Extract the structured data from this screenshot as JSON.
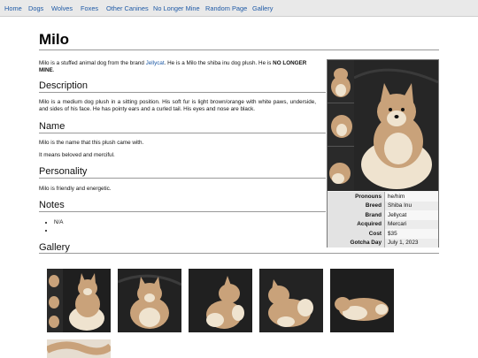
{
  "nav": {
    "items": [
      "Home",
      "Dogs",
      "Wolves",
      "Foxes",
      "Other Canines",
      "No Longer Mine",
      "Random Page",
      "Gallery"
    ]
  },
  "page": {
    "title": "Milo",
    "intro_pre": "Milo is a stuffed animal dog from the brand ",
    "intro_link": "Jellycat",
    "intro_mid": ". He is a Milo the shiba inu dog plush. He is ",
    "intro_bold": "NO LONGER MINE",
    "intro_end": "."
  },
  "sections": {
    "description_heading": "Description",
    "description_text": "Milo is a medium dog plush in a sitting position. His soft fur is light brown/orange with white paws, underside, and sides of his face. He has pointy ears and a curled tail. His eyes and nose are black.",
    "name_heading": "Name",
    "name_text_1": "Milo is the name that this plush came with.",
    "name_text_2": "It means beloved and merciful.",
    "personality_heading": "Personality",
    "personality_text": "Milo is friendly and energetic.",
    "notes_heading": "Notes",
    "notes_items": [
      "N/A",
      ""
    ],
    "gallery_heading": "Gallery"
  },
  "infobox": {
    "rows": [
      {
        "key": "Pronouns",
        "value": "he/him"
      },
      {
        "key": "Breed",
        "value": "Shiba Inu"
      },
      {
        "key": "Brand",
        "value": "Jellycat"
      },
      {
        "key": "Acquired",
        "value": "Mercari"
      },
      {
        "key": "Cost",
        "value": "$35"
      },
      {
        "key": "Gotcha Day",
        "value": "July 1, 2023"
      }
    ]
  },
  "colors": {
    "link": "#1f5aa6",
    "nav_bg": "#e9e9e9",
    "fur": "#c9a27a",
    "fur_light": "#efe3cf",
    "backdrop": "#1f1f1f"
  }
}
